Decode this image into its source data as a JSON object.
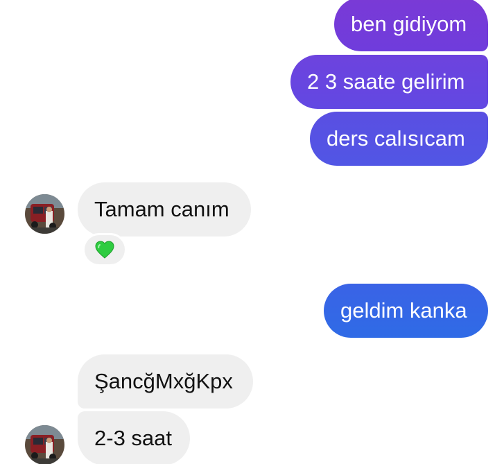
{
  "messages": {
    "outgoing": [
      {
        "text": "ben gidiyom"
      },
      {
        "text": "2 3 saate gelirim"
      },
      {
        "text": "ders calısıcam"
      },
      {
        "text": "geldim kanka"
      }
    ],
    "incoming": [
      {
        "text": "Tamam canım"
      },
      {
        "text": "ŞancğMxğKpx"
      },
      {
        "text": "2-3 saat"
      }
    ]
  },
  "reaction": {
    "emoji": "green-heart",
    "icon": "green-heart-icon"
  },
  "colors": {
    "outgoing_purple": "#7a3ad6",
    "outgoing_violet": "#6248e2",
    "outgoing_indigo": "#5156e5",
    "outgoing_blue": "#2f6be6",
    "incoming_bg": "#efefef",
    "incoming_text": "#111111",
    "heart": "#2ecc40"
  }
}
